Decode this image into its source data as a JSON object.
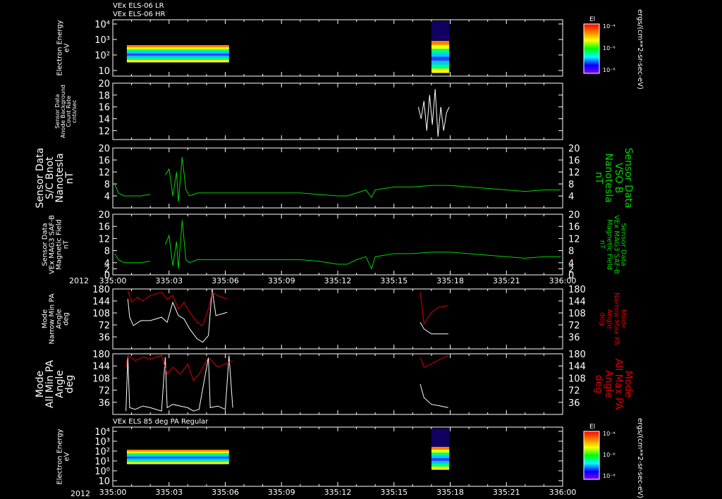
{
  "top_titles": [
    "VEx ELS-06 LR",
    "VEx ELS-06 HR"
  ],
  "bottom_title": "VEx ELS 85 deg PA Regular",
  "year_label": "2012",
  "x_tick_labels": [
    "335:00",
    "335:03",
    "335:06",
    "335:09",
    "335:12",
    "335:15",
    "335:18",
    "335:21",
    "336:00"
  ],
  "colorbar": {
    "title": "El",
    "unit": "ergs/(cm**2-sr-sec-eV)",
    "tick_labels": [
      "10⁻⁴",
      "10⁻⁶",
      "10⁻⁸"
    ],
    "stops": [
      "#ff0000",
      "#ff8000",
      "#ffff00",
      "#00ff00",
      "#00ffff",
      "#0000ff",
      "#8000ff"
    ]
  },
  "colors": {
    "white": "#ffffff",
    "green": "#00d400",
    "red": "#dd0000",
    "axis": "#ffffff"
  },
  "panels": [
    {
      "id": "electron-energy-top",
      "type": "heatmap",
      "left_label": [
        "Electron Energy",
        "eV"
      ],
      "y_ticks": [
        "10",
        "10²",
        "10³",
        "10⁴"
      ],
      "y_log_range": [
        0,
        4.2
      ]
    },
    {
      "id": "anode-background",
      "type": "line",
      "left_label": [
        "Sensor Data",
        "Anode Background",
        "Count Rate",
        "cnts/sec"
      ],
      "y_ticks": [
        12,
        14,
        16,
        18,
        20
      ],
      "ylim": [
        10.5,
        20
      ]
    },
    {
      "id": "sc-bnot",
      "type": "line",
      "left_label": [
        "Sensor Data",
        "S/C Bnot",
        "Nanotesla",
        "nT"
      ],
      "right_label": [
        "Sensor Data",
        "VSO B",
        "Nanotesla",
        "nT"
      ],
      "y_ticks": [
        4,
        8,
        12,
        16,
        20
      ],
      "ylim": [
        0,
        20
      ]
    },
    {
      "id": "mag-saf",
      "type": "line",
      "left_label": [
        "Sensor Data",
        "VEx MAG3 SAF-B",
        "Magnetic Field",
        "nT"
      ],
      "right_label": [
        "Sensor Data",
        "VEx MAG3 SAF-B",
        "Magnetic Field",
        "nT"
      ],
      "y_ticks": [
        0,
        2,
        4,
        8,
        12,
        16,
        20
      ],
      "ylim": [
        0,
        20
      ]
    },
    {
      "id": "narrow-pa",
      "type": "line",
      "left_label": [
        "Mode",
        "Narrow Min PA",
        "Angle",
        "deg"
      ],
      "right_label": [
        "Mode",
        "Narrow Max PA",
        "Angle",
        "deg"
      ],
      "y_ticks": [
        36,
        72,
        108,
        144,
        180
      ],
      "ylim": [
        0,
        180
      ]
    },
    {
      "id": "all-pa",
      "type": "line",
      "left_label": [
        "Mode",
        "All Min PA",
        "Angle",
        "deg"
      ],
      "right_label": [
        "Mode",
        "All Max PA",
        "Angle",
        "deg"
      ],
      "y_ticks": [
        36,
        72,
        108,
        144,
        180
      ],
      "ylim": [
        0,
        180
      ]
    },
    {
      "id": "electron-energy-bottom",
      "type": "heatmap",
      "left_label": [
        "Electron Energy",
        "eV"
      ],
      "y_ticks": [
        "10",
        "10⁰",
        "10¹",
        "10²",
        "10³",
        "10⁴"
      ],
      "y_log_range": [
        -1,
        4.2
      ]
    }
  ],
  "chart_data": {
    "type": "line",
    "x_unit": "DOY:hour",
    "xlim": [
      "335:00",
      "336:00"
    ],
    "series": [
      {
        "name": "Anode Background Count Rate",
        "panel": "anode-background",
        "segments": [
          [
            [
              16.3,
              16
            ],
            [
              16.45,
              14
            ],
            [
              16.6,
              17
            ],
            [
              16.75,
              12
            ],
            [
              16.9,
              18
            ],
            [
              17.05,
              13
            ],
            [
              17.2,
              19
            ],
            [
              17.35,
              11
            ],
            [
              17.5,
              16
            ],
            [
              17.65,
              12
            ],
            [
              17.8,
              15
            ],
            [
              17.95,
              16
            ]
          ]
        ]
      },
      {
        "name": "S/C Bnot",
        "panel": "sc-bnot",
        "segments": [
          [
            [
              0.1,
              8
            ],
            [
              0.3,
              5
            ],
            [
              0.6,
              4
            ],
            [
              1.0,
              4
            ],
            [
              1.5,
              4
            ],
            [
              2.0,
              4.5
            ]
          ],
          [
            [
              2.8,
              11
            ],
            [
              3.0,
              13
            ],
            [
              3.1,
              9
            ],
            [
              3.2,
              4
            ],
            [
              3.4,
              12
            ],
            [
              3.5,
              2
            ],
            [
              3.7,
              17
            ],
            [
              3.9,
              6
            ],
            [
              4.1,
              4
            ],
            [
              4.5,
              5
            ],
            [
              5,
              5
            ],
            [
              6,
              5
            ],
            [
              7,
              5
            ],
            [
              8,
              5
            ],
            [
              9,
              5
            ],
            [
              10,
              5
            ],
            [
              11,
              4.5
            ],
            [
              12,
              4
            ],
            [
              12.5,
              4
            ],
            [
              13,
              5
            ],
            [
              13.5,
              6
            ],
            [
              13.8,
              3.5
            ],
            [
              14,
              6
            ],
            [
              14.5,
              6.5
            ],
            [
              15,
              7
            ],
            [
              16,
              7
            ],
            [
              17,
              7.5
            ],
            [
              18,
              7.5
            ],
            [
              19,
              7
            ],
            [
              20,
              6.5
            ],
            [
              21,
              6
            ],
            [
              22,
              5.5
            ],
            [
              23,
              6
            ],
            [
              23.9,
              6
            ]
          ]
        ]
      },
      {
        "name": "VEx MAG3 SAF-B",
        "panel": "mag-saf",
        "segments": [
          [
            [
              0.1,
              7
            ],
            [
              0.3,
              5
            ],
            [
              0.6,
              4
            ],
            [
              1.0,
              4
            ],
            [
              1.5,
              4
            ],
            [
              2.0,
              4.5
            ]
          ],
          [
            [
              2.8,
              10
            ],
            [
              3.0,
              13
            ],
            [
              3.1,
              8
            ],
            [
              3.2,
              3
            ],
            [
              3.4,
              11
            ],
            [
              3.5,
              2
            ],
            [
              3.7,
              18
            ],
            [
              3.9,
              5
            ],
            [
              4.1,
              4
            ],
            [
              4.5,
              5
            ],
            [
              5,
              5
            ],
            [
              6,
              5
            ],
            [
              7,
              5
            ],
            [
              8,
              5
            ],
            [
              9,
              5
            ],
            [
              10,
              5
            ],
            [
              11,
              4.5
            ],
            [
              12,
              3.5
            ],
            [
              12.5,
              3.5
            ],
            [
              13,
              5
            ],
            [
              13.5,
              6
            ],
            [
              13.8,
              2
            ],
            [
              14,
              6
            ],
            [
              14.5,
              6.5
            ],
            [
              15,
              7
            ],
            [
              16,
              7
            ],
            [
              17,
              7.5
            ],
            [
              18,
              7.5
            ],
            [
              19,
              7
            ],
            [
              20,
              6.5
            ],
            [
              21,
              6
            ],
            [
              22,
              5.5
            ],
            [
              23,
              6
            ],
            [
              23.9,
              6
            ]
          ]
        ]
      },
      {
        "name": "Narrow Min PA",
        "panel": "narrow-pa",
        "segments": [
          [
            [
              0.8,
              150
            ],
            [
              0.9,
              95
            ],
            [
              1.1,
              70
            ],
            [
              1.5,
              85
            ],
            [
              2,
              85
            ],
            [
              2.6,
              95
            ],
            [
              2.9,
              80
            ],
            [
              3.2,
              140
            ],
            [
              3.5,
              100
            ],
            [
              3.8,
              90
            ],
            [
              4.1,
              60
            ],
            [
              4.5,
              30
            ],
            [
              4.8,
              20
            ],
            [
              5.1,
              40
            ],
            [
              5.3,
              180
            ],
            [
              5.5,
              100
            ],
            [
              6.1,
              110
            ]
          ],
          [
            [
              16.4,
              80
            ],
            [
              16.6,
              60
            ],
            [
              17,
              45
            ],
            [
              17.4,
              45
            ],
            [
              17.9,
              45
            ]
          ]
        ]
      },
      {
        "name": "Narrow Max PA",
        "panel": "narrow-pa",
        "segments": [
          [
            [
              0.8,
              175
            ],
            [
              1.0,
              140
            ],
            [
              1.3,
              155
            ],
            [
              1.6,
              145
            ],
            [
              2,
              160
            ],
            [
              2.6,
              170
            ],
            [
              2.9,
              150
            ],
            [
              3.2,
              160
            ],
            [
              3.5,
              120
            ],
            [
              3.8,
              140
            ],
            [
              4.1,
              110
            ],
            [
              4.5,
              80
            ],
            [
              4.8,
              70
            ],
            [
              5.1,
              120
            ],
            [
              5.3,
              170
            ],
            [
              5.6,
              160
            ],
            [
              6.1,
              150
            ]
          ],
          [
            [
              16.4,
              170
            ],
            [
              16.6,
              75
            ],
            [
              17,
              110
            ],
            [
              17.4,
              125
            ],
            [
              17.9,
              130
            ]
          ]
        ]
      },
      {
        "name": "All Min PA",
        "panel": "all-pa",
        "segments": [
          [
            [
              0.7,
              10
            ],
            [
              0.8,
              170
            ],
            [
              0.9,
              20
            ],
            [
              1.2,
              15
            ],
            [
              1.6,
              25
            ],
            [
              2.0,
              20
            ],
            [
              2.6,
              10
            ],
            [
              2.8,
              170
            ],
            [
              2.9,
              20
            ],
            [
              3.2,
              30
            ],
            [
              3.6,
              25
            ],
            [
              4.0,
              20
            ],
            [
              4.3,
              10
            ],
            [
              4.6,
              15
            ],
            [
              5.1,
              170
            ],
            [
              5.2,
              20
            ],
            [
              5.6,
              25
            ],
            [
              6.0,
              15
            ],
            [
              6.2,
              175
            ],
            [
              6.4,
              20
            ]
          ],
          [
            [
              16.4,
              90
            ],
            [
              16.6,
              50
            ],
            [
              17,
              30
            ],
            [
              17.5,
              25
            ],
            [
              17.9,
              20
            ]
          ]
        ]
      },
      {
        "name": "All Max PA",
        "panel": "all-pa",
        "segments": [
          [
            [
              0.7,
              140
            ],
            [
              0.8,
              175
            ],
            [
              1.2,
              160
            ],
            [
              1.6,
              170
            ],
            [
              2.0,
              165
            ],
            [
              2.6,
              175
            ],
            [
              2.9,
              120
            ],
            [
              3.2,
              140
            ],
            [
              3.6,
              120
            ],
            [
              4.0,
              150
            ],
            [
              4.3,
              100
            ],
            [
              4.6,
              120
            ],
            [
              5.1,
              170
            ],
            [
              5.6,
              140
            ],
            [
              6.0,
              150
            ],
            [
              6.4,
              160
            ]
          ],
          [
            [
              16.4,
              170
            ],
            [
              16.6,
              140
            ],
            [
              17,
              150
            ],
            [
              17.5,
              165
            ],
            [
              17.9,
              175
            ]
          ]
        ]
      }
    ]
  }
}
